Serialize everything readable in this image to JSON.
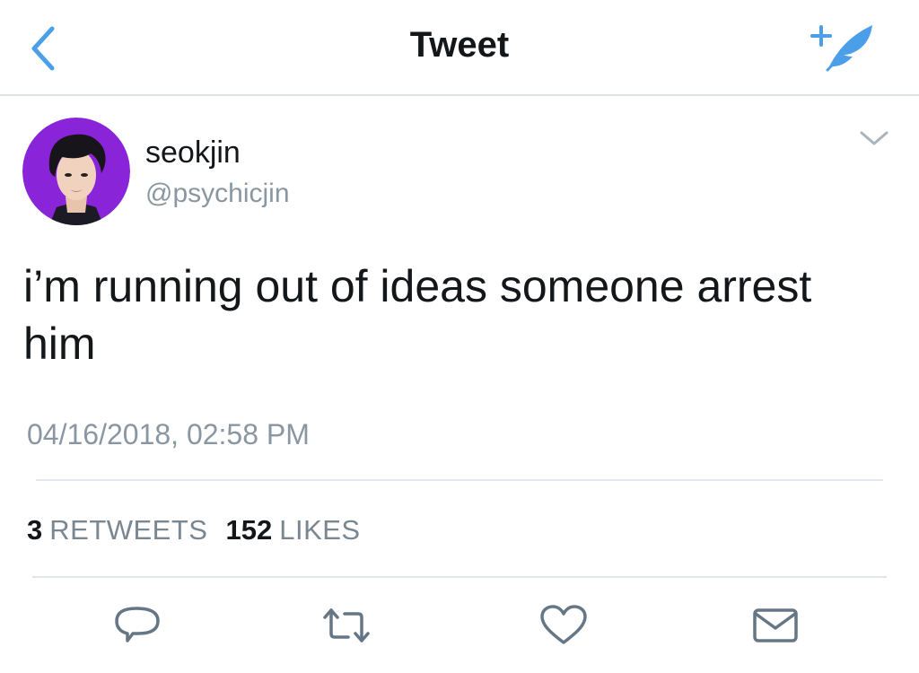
{
  "header": {
    "title": "Tweet",
    "back_icon": "chevron-left-icon",
    "compose_icon": "compose-tweet-icon",
    "accent_color": "#4a9fe8"
  },
  "tweet": {
    "author": {
      "name": "seokjin",
      "handle": "@psychicjin",
      "avatar_bg": "#8a24d8"
    },
    "text": "i’m running out of ideas someone arrest him",
    "timestamp": "04/16/2018, 02:58 PM",
    "stats": [
      {
        "count": "3",
        "label": "RETWEETS"
      },
      {
        "count": "152",
        "label": "LIKES"
      }
    ],
    "actions": [
      {
        "name": "reply",
        "icon": "reply-icon"
      },
      {
        "name": "retweet",
        "icon": "retweet-icon"
      },
      {
        "name": "like",
        "icon": "heart-icon"
      },
      {
        "name": "direct-message",
        "icon": "envelope-icon"
      }
    ]
  }
}
